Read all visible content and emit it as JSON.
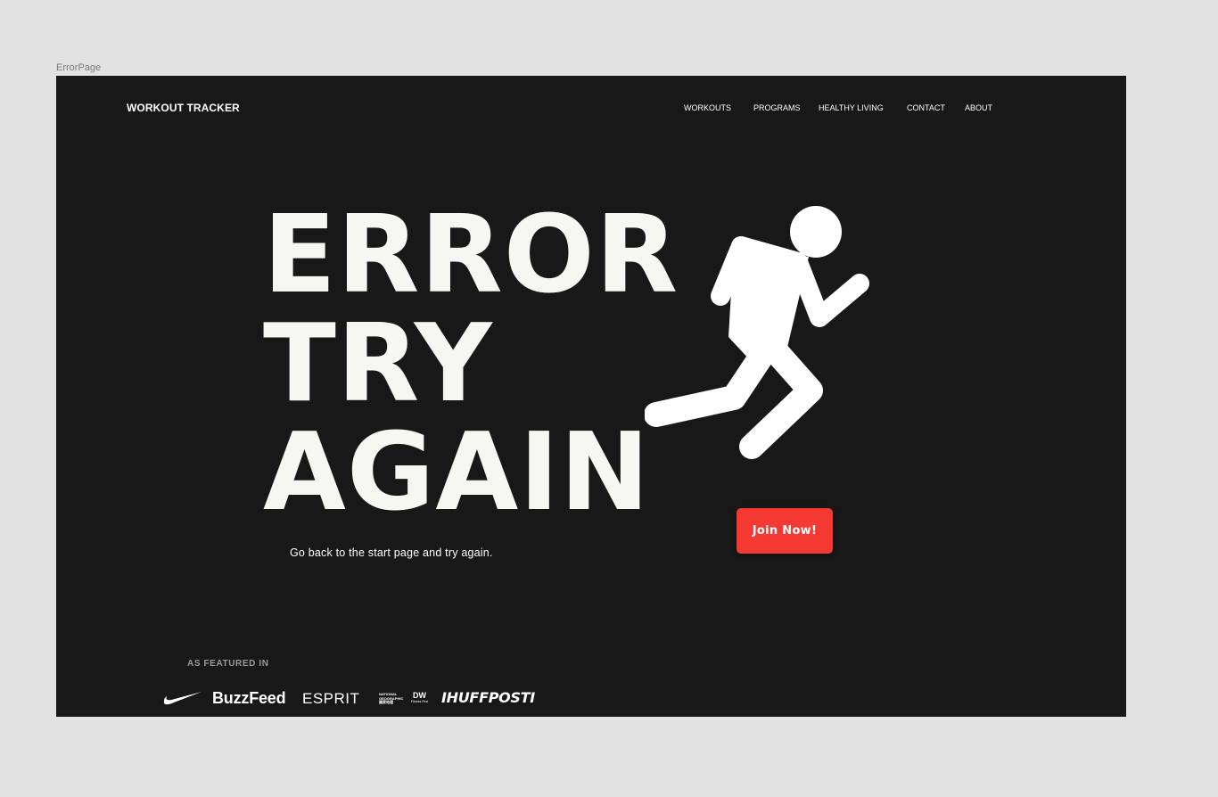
{
  "canvas": {
    "frame_label": "ErrorPage"
  },
  "header": {
    "brand": "WORKOUT TRACKER",
    "nav": [
      "WORKOUTS",
      "PROGRAMS",
      "HEALTHY LIVING",
      "CONTACT",
      "ABOUT"
    ]
  },
  "hero": {
    "headline": [
      "ERROR",
      "TRY",
      "AGAIN"
    ],
    "subtext": "Go back to the start page and try again.",
    "cta_label": "Join Now!",
    "illustration_icon": "running-man-icon"
  },
  "featured": {
    "label": "AS FEATURED IN",
    "logos": {
      "nike": "nike-swoosh-icon",
      "buzzfeed": "BuzzFeed",
      "esprit": "ESPRIT",
      "natgeo": "NATIONAL GEOGRAPHIC 國家地理",
      "dw_mark": "DW",
      "dw_sub": "Fitness First",
      "huffpost": "IHUFFPOSTI"
    }
  },
  "colors": {
    "canvas_bg": "#e2e2e2",
    "page_bg": "#181818",
    "headline": "#f7f7f2",
    "accent": "#f43a33",
    "text": "#ffffff",
    "muted": "#9a9a9a"
  }
}
